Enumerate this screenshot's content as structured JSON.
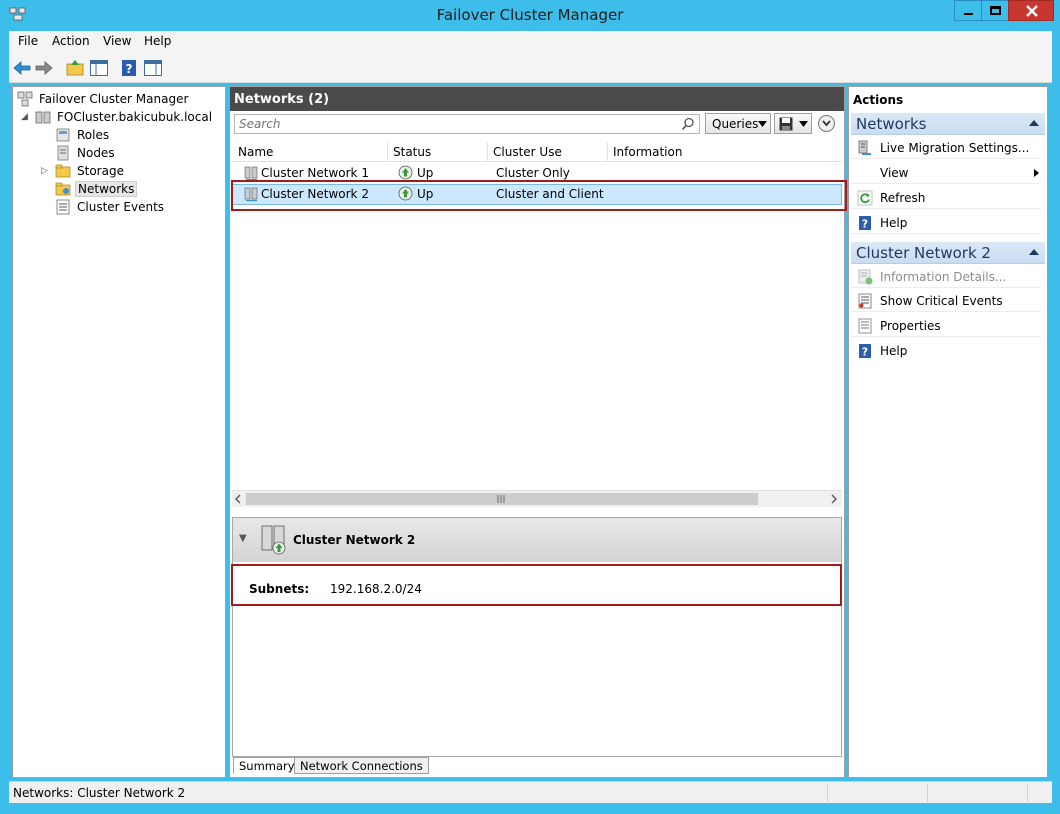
{
  "window": {
    "title": "Failover Cluster Manager"
  },
  "menu": [
    "File",
    "Action",
    "View",
    "Help"
  ],
  "tree": {
    "root": "Failover Cluster Manager",
    "cluster": "FOCluster.bakicubuk.local",
    "children": [
      "Roles",
      "Nodes",
      "Storage",
      "Networks",
      "Cluster Events"
    ],
    "selected": "Networks"
  },
  "main": {
    "header": "Networks (2)",
    "search_placeholder": "Search",
    "queries_label": "Queries",
    "columns": [
      "Name",
      "Status",
      "Cluster Use",
      "Information"
    ],
    "rows": [
      {
        "name": "Cluster Network 1",
        "status": "Up",
        "cluster_use": "Cluster Only",
        "information": ""
      },
      {
        "name": "Cluster Network 2",
        "status": "Up",
        "cluster_use": "Cluster and Client",
        "information": ""
      }
    ],
    "selected_row": 1
  },
  "details": {
    "title": "Cluster Network 2",
    "subnets_label": "Subnets:",
    "subnets_value": "192.168.2.0/24",
    "tabs": [
      "Summary",
      "Network Connections"
    ],
    "active_tab": "Summary"
  },
  "actions": {
    "title": "Actions",
    "sections": [
      {
        "label": "Networks",
        "items": [
          {
            "label": "Live Migration Settings...",
            "icon": "live-migration-icon"
          },
          {
            "label": "View",
            "icon": "none",
            "submenu": true
          },
          {
            "label": "Refresh",
            "icon": "refresh-icon"
          },
          {
            "label": "Help",
            "icon": "help-icon"
          }
        ]
      },
      {
        "label": "Cluster Network 2",
        "items": [
          {
            "label": "Information Details...",
            "icon": "info-details-icon",
            "disabled": true
          },
          {
            "label": "Show Critical Events",
            "icon": "critical-events-icon"
          },
          {
            "label": "Properties",
            "icon": "properties-icon"
          },
          {
            "label": "Help",
            "icon": "help-icon"
          }
        ]
      }
    ]
  },
  "statusbar": {
    "text": "Networks:  Cluster Network 2"
  },
  "colors": {
    "titlebar": "#3dbdea",
    "close": "#c7372f",
    "selection": "#cce8ff",
    "highlight_box": "#a11c1c",
    "status_up": "#3a9a3a"
  }
}
